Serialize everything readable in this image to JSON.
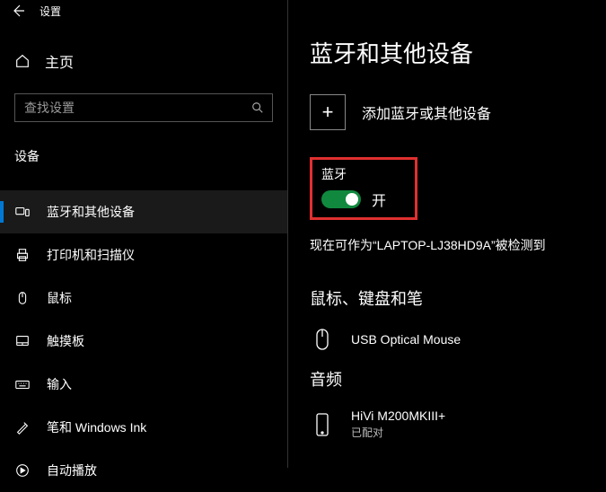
{
  "titlebar": {
    "title": "设置"
  },
  "sidebar": {
    "home_label": "主页",
    "search_placeholder": "查找设置",
    "section_label": "设备",
    "items": [
      {
        "label": "蓝牙和其他设备"
      },
      {
        "label": "打印机和扫描仪"
      },
      {
        "label": "鼠标"
      },
      {
        "label": "触摸板"
      },
      {
        "label": "输入"
      },
      {
        "label": "笔和 Windows Ink"
      },
      {
        "label": "自动播放"
      }
    ]
  },
  "main": {
    "page_title": "蓝牙和其他设备",
    "add_label": "添加蓝牙或其他设备",
    "plus_glyph": "+",
    "bluetooth": {
      "label": "蓝牙",
      "state": "开"
    },
    "discoverable_text": "现在可作为“LAPTOP-LJ38HD9A”被检测到",
    "section_mouse_kb": "鼠标、键盘和笔",
    "device_mouse": {
      "name": "USB Optical Mouse"
    },
    "section_audio": "音频",
    "device_audio": {
      "name": "HiVi M200MKIII+",
      "status": "已配对"
    }
  }
}
